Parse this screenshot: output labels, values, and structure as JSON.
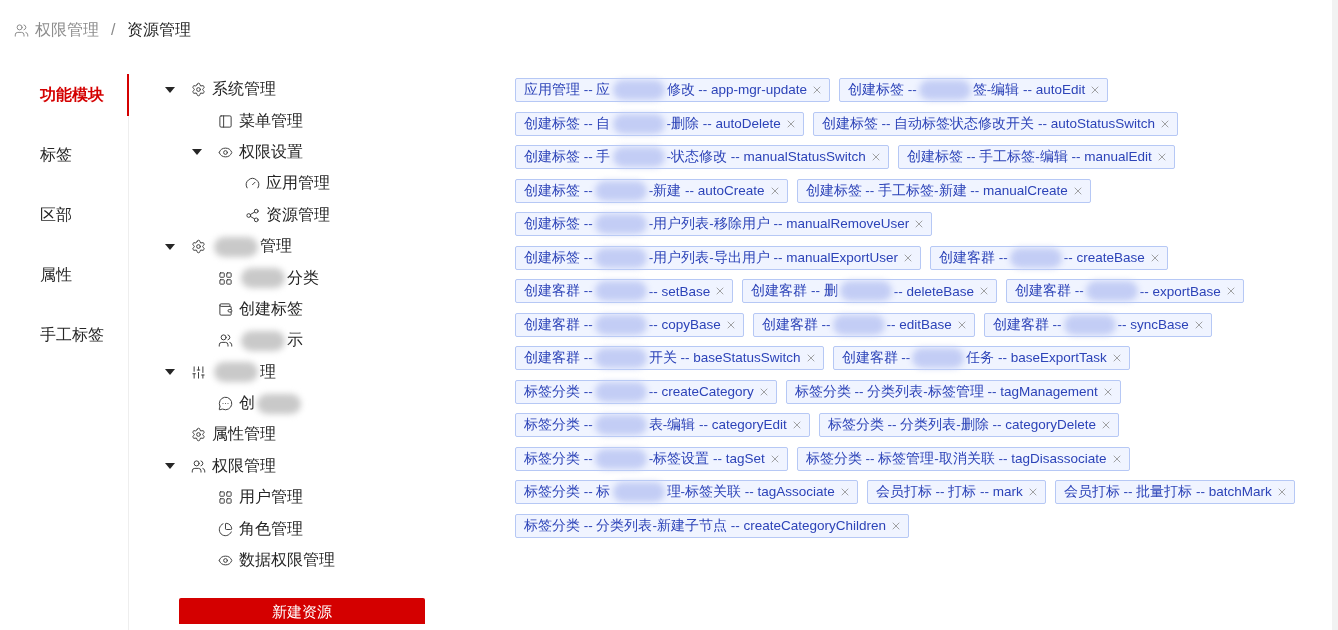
{
  "breadcrumb_separator": "/",
  "breadcrumb": [
    {
      "label": "权限管理",
      "current": false
    },
    {
      "label": "资源管理",
      "current": true
    }
  ],
  "side_tabs": [
    {
      "label": "功能模块",
      "selected": true
    },
    {
      "label": "标签",
      "selected": false
    },
    {
      "label": "区部",
      "selected": false
    },
    {
      "label": "属性",
      "selected": false
    },
    {
      "label": "手工标签",
      "selected": false
    }
  ],
  "tree": [
    {
      "before": "系统管理",
      "expanded": true,
      "children": [
        {
          "before": "菜单管理"
        },
        {
          "before": "权限设置",
          "expanded": true,
          "children": [
            {
              "before": "应用管理"
            },
            {
              "before": "资源管理"
            }
          ]
        }
      ]
    },
    {
      "blurred": true,
      "after": "管理",
      "expanded": true,
      "children": [
        {
          "blurred": true,
          "after": "分类"
        },
        {
          "before": "创建标签"
        },
        {
          "blurred": true,
          "after": "示"
        }
      ]
    },
    {
      "blurred": true,
      "after": "理",
      "expanded": true,
      "children": [
        {
          "before": "创",
          "blurred": true
        }
      ]
    },
    {
      "before": "属性管理"
    },
    {
      "before": "权限管理",
      "expanded": true,
      "children": [
        {
          "before": "用户管理"
        },
        {
          "before": "角色管理"
        },
        {
          "before": "数据权限管理"
        }
      ]
    }
  ],
  "new_button": "新建资源",
  "tag_rows": [
    [
      {
        "before": "应用管理 -- 应",
        "blurred": true,
        "after": "修改 -- app-mgr-update"
      },
      {
        "before": "创建标签 --",
        "blurred": true,
        "after": "签-编辑 -- autoEdit"
      }
    ],
    [
      {
        "before": "创建标签 -- 自",
        "blurred": true,
        "after": "-删除 -- autoDelete"
      },
      {
        "before": "创建标签 -- 自动标签状态修改开关 -- autoStatusSwitch"
      }
    ],
    [
      {
        "before": "创建标签 -- 手",
        "blurred": true,
        "after": "-状态修改 -- manualStatusSwitch"
      },
      {
        "before": "创建标签 -- 手工标签-编辑 -- manualEdit"
      }
    ],
    [
      {
        "before": "创建标签 --",
        "blurred": true,
        "after": "-新建 -- autoCreate"
      },
      {
        "before": "创建标签 -- 手工标签-新建 -- manualCreate"
      }
    ],
    [
      {
        "before": "创建标签 --",
        "blurred": true,
        "after": "-用户列表-移除用户 -- manualRemoveUser"
      }
    ],
    [
      {
        "before": "创建标签 --",
        "blurred": true,
        "after": "-用户列表-导出用户 -- manualExportUser"
      },
      {
        "before": "创建客群 --",
        "blurred": true,
        "after": "-- createBase"
      }
    ],
    [
      {
        "before": "创建客群 --",
        "blurred": true,
        "after": "-- setBase"
      },
      {
        "before": "创建客群 -- 删",
        "blurred": true,
        "after": "-- deleteBase"
      },
      {
        "before": "创建客群 --",
        "blurred": true,
        "after": "-- exportBase"
      }
    ],
    [
      {
        "before": "创建客群 --",
        "blurred": true,
        "after": "-- copyBase"
      },
      {
        "before": "创建客群 --",
        "blurred": true,
        "after": "-- editBase"
      },
      {
        "before": "创建客群 --",
        "blurred": true,
        "after": "-- syncBase"
      }
    ],
    [
      {
        "before": "创建客群 --",
        "blurred": true,
        "after": "开关 -- baseStatusSwitch"
      },
      {
        "before": "创建客群 --",
        "blurred": true,
        "after": "任务 -- baseExportTask"
      }
    ],
    [
      {
        "before": "标签分类 --",
        "blurred": true,
        "after": "-- createCategory"
      },
      {
        "before": "标签分类 -- 分类列表-标签管理 -- tagManagement"
      }
    ],
    [
      {
        "before": "标签分类 --",
        "blurred": true,
        "after": "表-编辑 -- categoryEdit"
      },
      {
        "before": "标签分类 -- 分类列表-删除 -- categoryDelete"
      }
    ],
    [
      {
        "before": "标签分类 --",
        "blurred": true,
        "after": "-标签设置 -- tagSet"
      },
      {
        "before": "标签分类 -- 标签管理-取消关联 -- tagDisassociate"
      }
    ],
    [
      {
        "before": "标签分类 -- 标",
        "blurred": true,
        "after": "理-标签关联 -- tagAssociate"
      },
      {
        "before": "会员打标 -- 打标 -- mark"
      },
      {
        "before": "会员打标 -- 批量打标 -- batchMark"
      }
    ],
    [
      {
        "before": "标签分类 -- 分类列表-新建子节点 -- createCategoryChildren"
      }
    ]
  ]
}
